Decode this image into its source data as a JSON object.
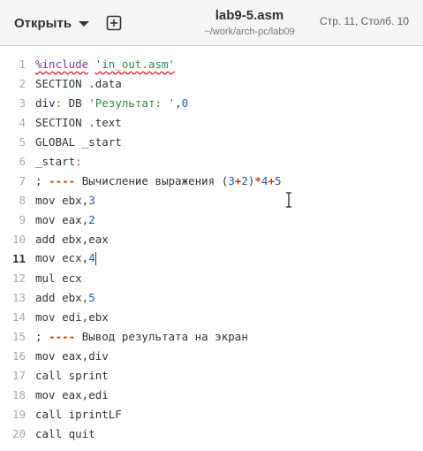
{
  "header": {
    "open_label": "Открыть",
    "title": "lab9-5.asm",
    "subtitle": "~/work/arch-pc/lab09",
    "position": "Стр. 11, Столб. 10"
  },
  "icons": {
    "open_menu": "chevron-down-icon",
    "new_tab": "new-tab-icon",
    "mouse": "text-cursor-icon"
  },
  "colors": {
    "headerbar": "#f6f5f4",
    "line_numbers": "#a9a9ad",
    "preprocessor": "#7e3a94",
    "string": "#2a8a3e",
    "number": "#1c5dbf",
    "operator": "#c7410a",
    "spell_underline": "#e01b24"
  },
  "editor": {
    "current_line": 11,
    "lines": [
      {
        "n": "1",
        "tokens": [
          {
            "t": "%include",
            "c": "kw-pp spell"
          },
          {
            "t": " "
          },
          {
            "t": "'in_out.asm'",
            "c": "str spell"
          }
        ]
      },
      {
        "n": "2",
        "tokens": [
          {
            "t": "SECTION .data"
          }
        ]
      },
      {
        "n": "3",
        "tokens": [
          {
            "t": "div"
          },
          {
            "t": ":",
            "c": "lbl"
          },
          {
            "t": " DB "
          },
          {
            "t": "'Результат: '",
            "c": "str"
          },
          {
            "t": ","
          },
          {
            "t": "0",
            "c": "num"
          }
        ]
      },
      {
        "n": "4",
        "tokens": [
          {
            "t": "SECTION .text"
          }
        ]
      },
      {
        "n": "5",
        "tokens": [
          {
            "t": "GLOBAL _start"
          }
        ]
      },
      {
        "n": "6",
        "tokens": [
          {
            "t": "_start"
          },
          {
            "t": ":",
            "c": "lbl"
          }
        ]
      },
      {
        "n": "7",
        "tokens": [
          {
            "t": "; "
          },
          {
            "t": "----",
            "c": "op"
          },
          {
            "t": " Вычисление выражения ("
          },
          {
            "t": "3",
            "c": "num"
          },
          {
            "t": "+",
            "c": "op"
          },
          {
            "t": "2",
            "c": "num"
          },
          {
            "t": ")"
          },
          {
            "t": "*",
            "c": "op"
          },
          {
            "t": "4",
            "c": "num"
          },
          {
            "t": "+",
            "c": "op"
          },
          {
            "t": "5",
            "c": "num"
          }
        ]
      },
      {
        "n": "8",
        "tokens": [
          {
            "t": "mov ebx,"
          },
          {
            "t": "3",
            "c": "num"
          }
        ]
      },
      {
        "n": "9",
        "tokens": [
          {
            "t": "mov eax,"
          },
          {
            "t": "2",
            "c": "num"
          }
        ]
      },
      {
        "n": "10",
        "tokens": [
          {
            "t": "add ebx,eax"
          }
        ]
      },
      {
        "n": "11",
        "tokens": [
          {
            "t": "mov ecx,"
          },
          {
            "t": "4",
            "c": "num"
          }
        ],
        "caret": true
      },
      {
        "n": "12",
        "tokens": [
          {
            "t": "mul ecx"
          }
        ]
      },
      {
        "n": "13",
        "tokens": [
          {
            "t": "add ebx,"
          },
          {
            "t": "5",
            "c": "num"
          }
        ]
      },
      {
        "n": "14",
        "tokens": [
          {
            "t": "mov edi,ebx"
          }
        ]
      },
      {
        "n": "15",
        "tokens": [
          {
            "t": "; "
          },
          {
            "t": "----",
            "c": "op"
          },
          {
            "t": " Вывод результата на экран"
          }
        ]
      },
      {
        "n": "16",
        "tokens": [
          {
            "t": "mov eax,div"
          }
        ]
      },
      {
        "n": "17",
        "tokens": [
          {
            "t": "call sprint"
          }
        ]
      },
      {
        "n": "18",
        "tokens": [
          {
            "t": "mov eax,edi"
          }
        ]
      },
      {
        "n": "19",
        "tokens": [
          {
            "t": "call iprintLF"
          }
        ]
      },
      {
        "n": "20",
        "tokens": [
          {
            "t": "call quit"
          }
        ]
      }
    ]
  }
}
